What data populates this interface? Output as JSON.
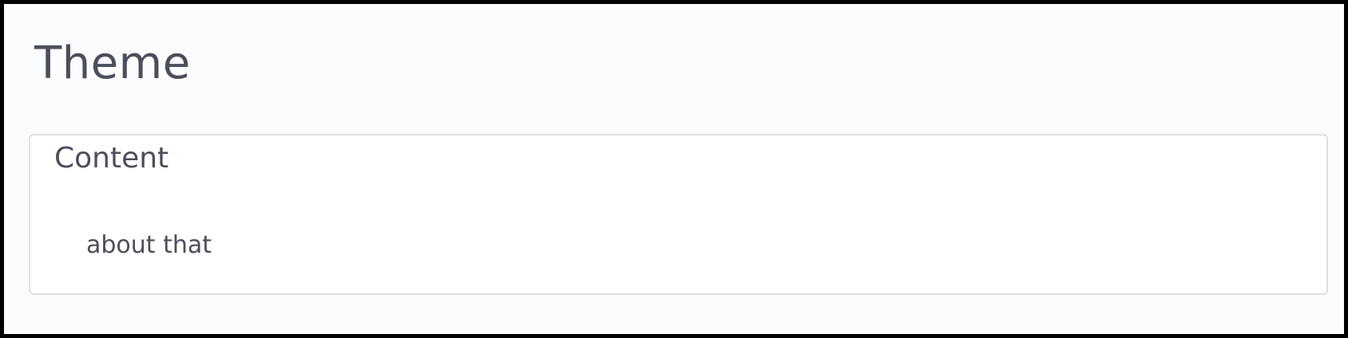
{
  "page": {
    "title": "Theme"
  },
  "card": {
    "title": "Content",
    "body": "about that"
  },
  "colors": {
    "text": "#4b4e5c",
    "background": "#fbfcfe",
    "card_border": "#dedfe1"
  }
}
